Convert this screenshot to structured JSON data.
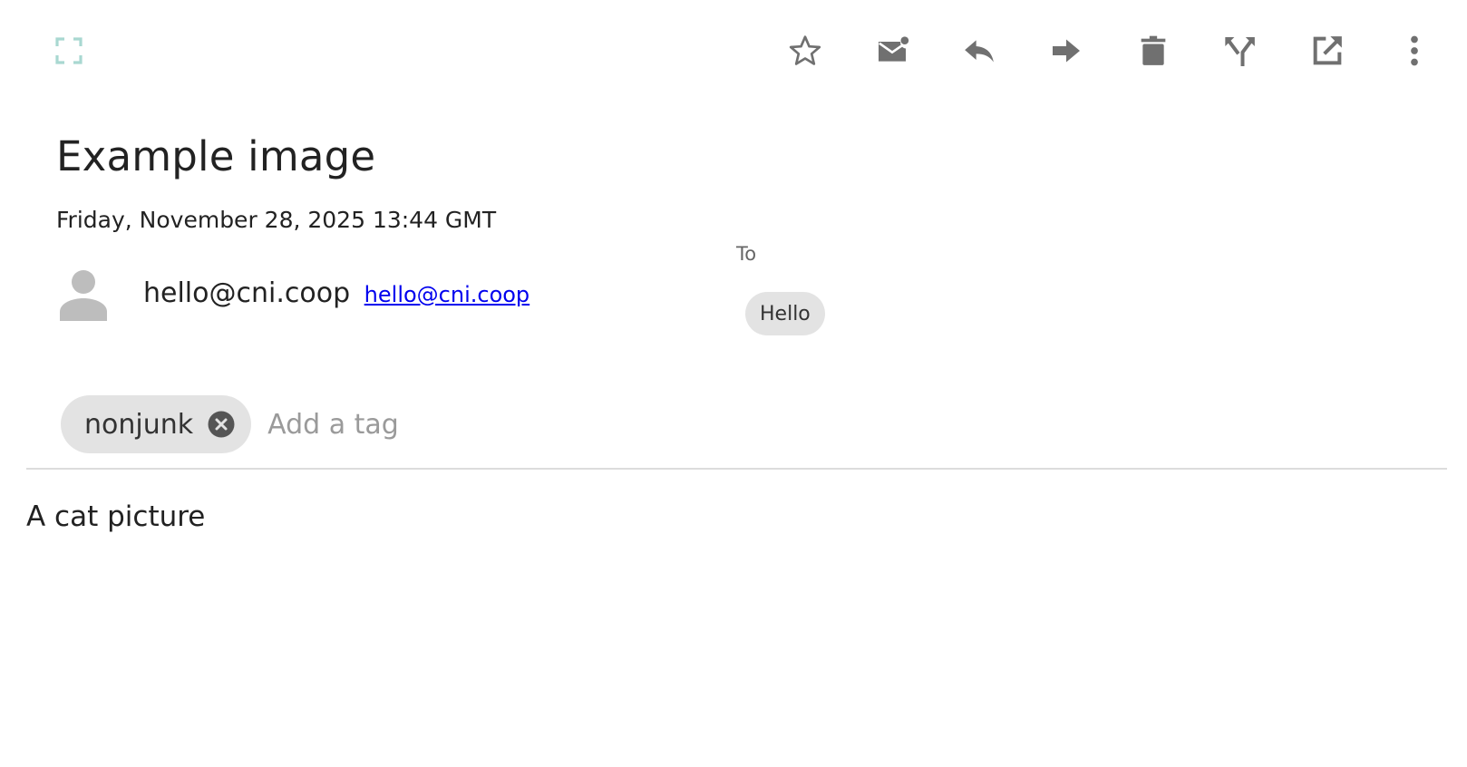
{
  "toolbar": {
    "fullscreen_icon": "fullscreen-icon",
    "buttons": [
      {
        "icon": "star-outline-icon"
      },
      {
        "icon": "mark-unread-icon"
      },
      {
        "icon": "reply-icon"
      },
      {
        "icon": "forward-icon"
      },
      {
        "icon": "trash-icon"
      },
      {
        "icon": "split-thread-icon"
      },
      {
        "icon": "open-external-icon"
      },
      {
        "icon": "more-vertical-icon"
      }
    ],
    "icon_color": "#707070",
    "fullscreen_icon_color": "#a9d8d1"
  },
  "message": {
    "subject": "Example image",
    "date": "Friday, November 28, 2025 13:44 GMT",
    "from_name": "hello@cni.coop",
    "from_email": "hello@cni.coop",
    "to_label": "To",
    "recipients": [
      "Hello"
    ],
    "body": "A cat picture"
  },
  "tags": {
    "items": [
      "nonjunk"
    ],
    "input_placeholder": "Add a tag",
    "input_value": ""
  },
  "colors": {
    "chip_bg": "#e3e3e3",
    "link": "#0000ee",
    "avatar": "#bdbdbd"
  }
}
